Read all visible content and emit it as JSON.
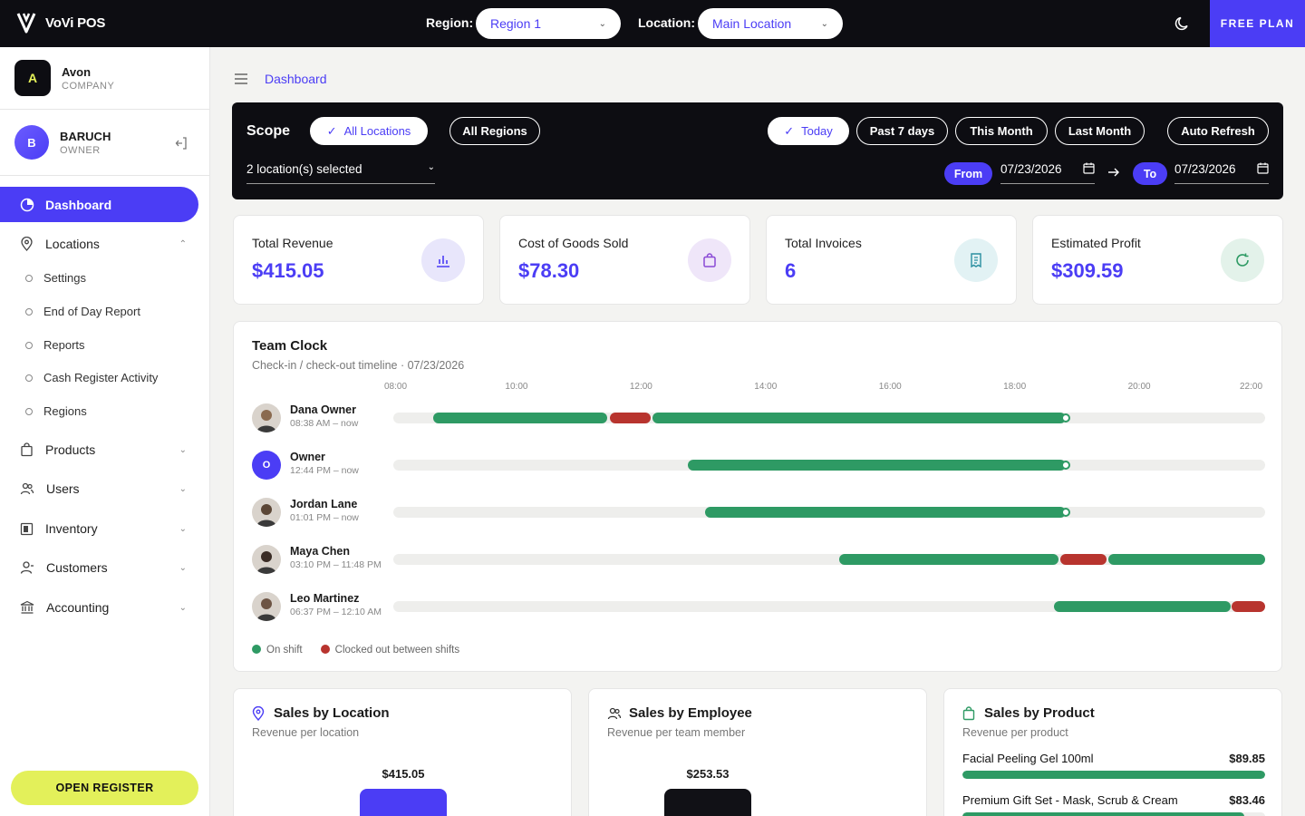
{
  "topbar": {
    "brand": "VoVi POS",
    "region_label": "Region:",
    "region_value": "Region 1",
    "location_label": "Location:",
    "location_value": "Main Location",
    "plan": "FREE PLAN"
  },
  "sidebar": {
    "company": {
      "initial": "A",
      "name": "Avon",
      "sub": "COMPANY"
    },
    "user": {
      "initial": "B",
      "name": "BARUCH",
      "role": "OWNER"
    },
    "active": "Dashboard",
    "locations_label": "Locations",
    "sub_items": [
      "Settings",
      "End of Day Report",
      "Reports",
      "Cash Register Activity",
      "Regions"
    ],
    "items": [
      "Products",
      "Users",
      "Inventory",
      "Customers",
      "Accounting"
    ],
    "open_register": "OPEN REGISTER"
  },
  "breadcrumb": "Dashboard",
  "scope": {
    "title": "Scope",
    "all_locations": "All Locations",
    "all_regions": "All Regions",
    "ranges": [
      "Today",
      "Past 7 days",
      "This Month",
      "Last Month"
    ],
    "auto_refresh": "Auto Refresh",
    "locations_selected": "2 location(s) selected",
    "from_label": "From",
    "from_date": "07/23/2026",
    "to_label": "To",
    "to_date": "07/23/2026"
  },
  "kpis": [
    {
      "label": "Total Revenue",
      "value": "$415.05",
      "icon": "bar-chart-icon",
      "color": "#e8e6fb"
    },
    {
      "label": "Cost of Goods Sold",
      "value": "$78.30",
      "icon": "shopping-bag-icon",
      "color": "#efe6f9"
    },
    {
      "label": "Total Invoices",
      "value": "6",
      "icon": "receipt-icon",
      "color": "#e2f2f4"
    },
    {
      "label": "Estimated Profit",
      "value": "$309.59",
      "icon": "refresh-icon",
      "color": "#e3f2ea"
    }
  ],
  "team_clock": {
    "title": "Team Clock",
    "subtitle": "Check-in / check-out timeline · 07/23/2026",
    "ticks": [
      "08:00",
      "10:00",
      "12:00",
      "14:00",
      "16:00",
      "18:00",
      "20:00",
      "22:00"
    ],
    "rows": [
      {
        "name": "Dana Owner",
        "time": "08:38 AM – now",
        "segments": [
          [
            0.046,
            0.245,
            "on"
          ],
          [
            0.248,
            0.295,
            "off"
          ],
          [
            0.297,
            0.771,
            "on"
          ]
        ],
        "now": 0.771
      },
      {
        "name": "Owner",
        "initial": "O",
        "time": "12:44 PM – now",
        "segments": [
          [
            0.338,
            0.771,
            "on"
          ]
        ],
        "now": 0.771
      },
      {
        "name": "Jordan Lane",
        "time": "01:01 PM – now",
        "segments": [
          [
            0.358,
            0.771,
            "on"
          ]
        ],
        "now": 0.771
      },
      {
        "name": "Maya Chen",
        "time": "03:10 PM – 11:48 PM",
        "segments": [
          [
            0.511,
            0.763,
            "on"
          ],
          [
            0.765,
            0.818,
            "off"
          ],
          [
            0.82,
            1.0,
            "on"
          ]
        ]
      },
      {
        "name": "Leo Martinez",
        "time": "06:37 PM – 12:10 AM",
        "segments": [
          [
            0.758,
            0.96,
            "on"
          ],
          [
            0.962,
            1.0,
            "off"
          ]
        ]
      }
    ],
    "legend_on": "On shift",
    "legend_off": "Clocked out between shifts"
  },
  "sales_location": {
    "title": "Sales by Location",
    "subtitle": "Revenue per location",
    "value": "$415.05"
  },
  "sales_employee": {
    "title": "Sales by Employee",
    "subtitle": "Revenue per team member",
    "value": "$253.53"
  },
  "sales_product": {
    "title": "Sales by Product",
    "subtitle": "Revenue per product",
    "products": [
      {
        "name": "Facial Peeling Gel 100ml",
        "value": "$89.85",
        "fill": 1.0
      },
      {
        "name": "Premium Gift Set - Mask, Scrub & Cream",
        "value": "$83.46",
        "fill": 0.93
      }
    ]
  },
  "colors": {
    "accent": "#4b3df5",
    "on_shift": "#2e9a64",
    "off_shift": "#b8342e",
    "lime": "#e3f05a"
  }
}
